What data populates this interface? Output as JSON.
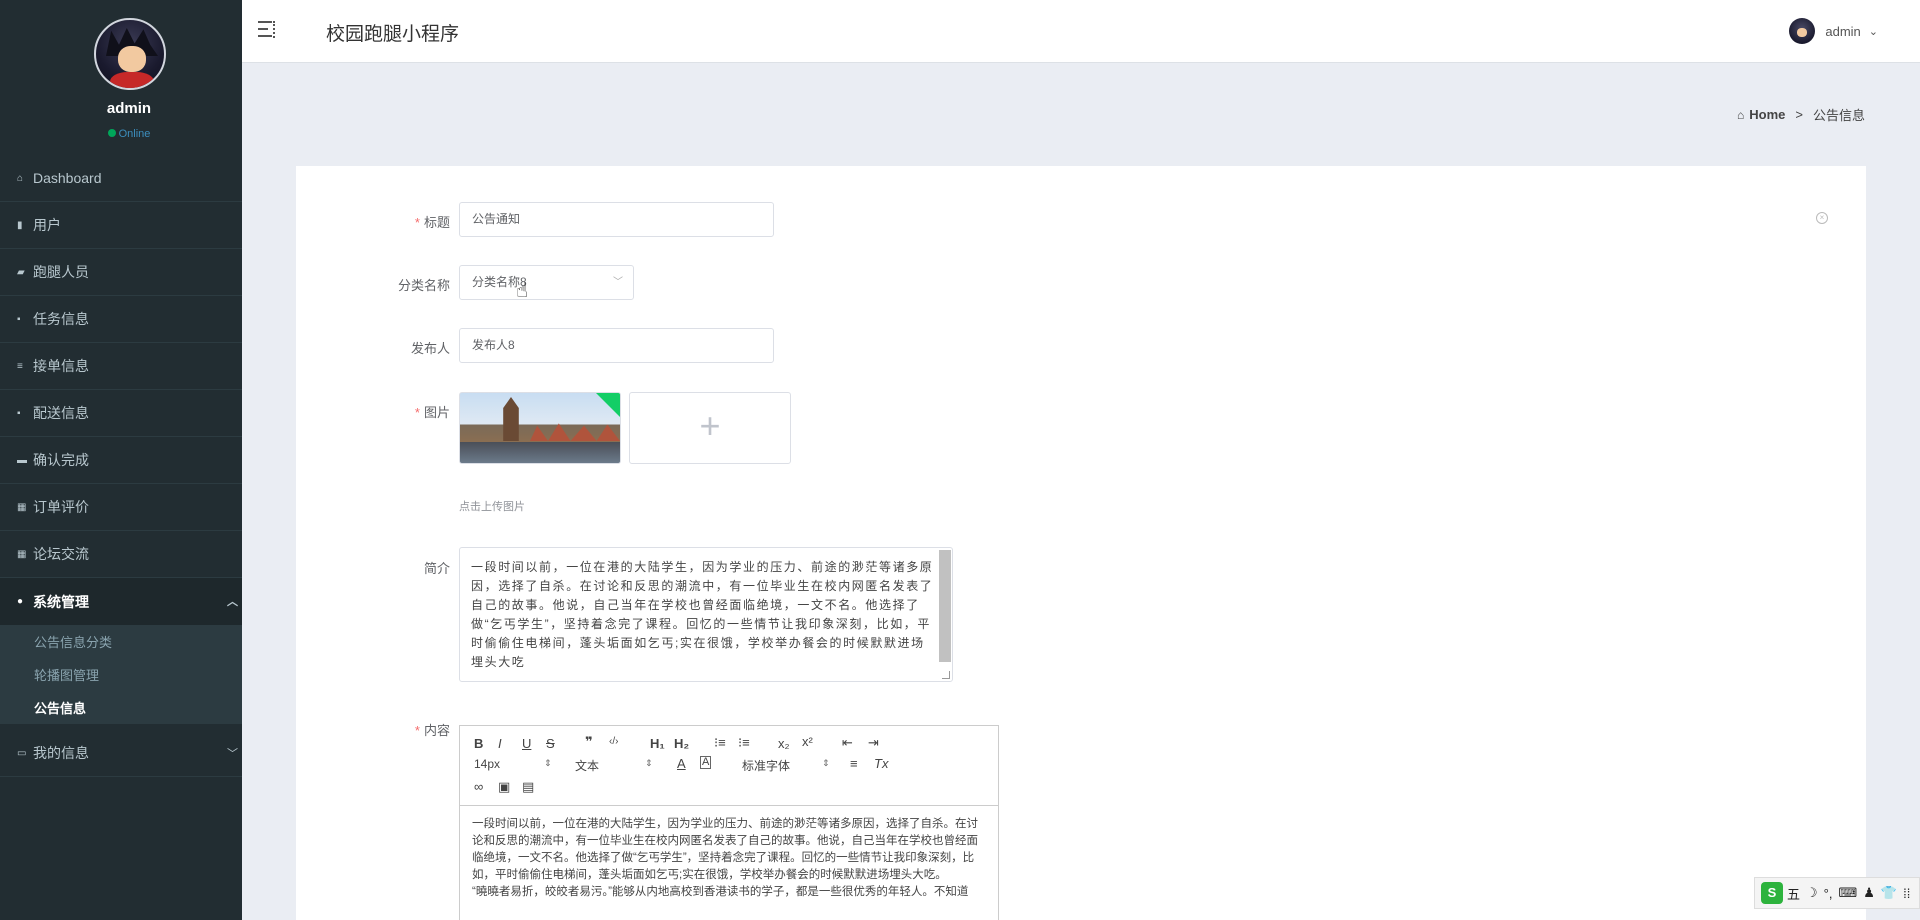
{
  "sidebar": {
    "user_name": "admin",
    "user_status": "Online",
    "items": [
      {
        "label": "Dashboard",
        "icon": "home-icon"
      },
      {
        "label": "用户",
        "icon": "bar-chart-icon"
      },
      {
        "label": "跑腿人员",
        "icon": "truck-icon"
      },
      {
        "label": "任务信息",
        "icon": "file-icon"
      },
      {
        "label": "接单信息",
        "icon": "list-icon"
      },
      {
        "label": "配送信息",
        "icon": "delivery-icon"
      },
      {
        "label": "确认完成",
        "icon": "check-box-icon"
      },
      {
        "label": "订单评价",
        "icon": "grid-icon"
      },
      {
        "label": "论坛交流",
        "icon": "grid-icon"
      },
      {
        "label": "系统管理",
        "icon": "user-icon"
      },
      {
        "label": "我的信息",
        "icon": "card-icon"
      }
    ],
    "sub_items": [
      {
        "label": "公告信息分类"
      },
      {
        "label": "轮播图管理"
      },
      {
        "label": "公告信息"
      }
    ]
  },
  "header": {
    "title": "校园跑腿小程序",
    "user": "admin"
  },
  "breadcrumb": {
    "home": "Home",
    "separator": ">",
    "current": "公告信息"
  },
  "form": {
    "title_label": "标题",
    "title_value": "公告通知",
    "category_label": "分类名称",
    "category_value": "分类名称8",
    "publisher_label": "发布人",
    "publisher_value": "发布人8",
    "image_label": "图片",
    "upload_plus": "+",
    "upload_hint": "点击上传图片",
    "summary_label": "简介",
    "summary_value": "一段时间以前，一位在港的大陆学生，因为学业的压力、前途的渺茫等诸多原因，选择了自杀。在讨论和反思的潮流中，有一位毕业生在校内网匿名发表了自己的故事。他说，自己当年在学校也曾经面临绝境，一文不名。他选择了做“乞丐学生”，坚持着念完了课程。回忆的一些情节让我印象深刻，比如，平时偷偷住电梯间，蓬头垢面如乞丐;实在很饿，学校举办餐会的时候默默进场埋头大吃",
    "content_label": "内容"
  },
  "editor": {
    "font_size": "14px",
    "block_type": "文本",
    "font_family": "标准字体",
    "body_line1": "一段时间以前，一位在港的大陆学生，因为学业的压力、前途的渺茫等诸多原因，选择了自杀。在讨论和反思的潮流中，有一位毕业生在校内网匿名发表了自己的故事。他说，自己当年在学校也曾经面临绝境，一文不名。他选择了做“乞丐学生”，坚持着念完了课程。回忆的一些情节让我印象深刻，比如，平时偷偷住电梯间，蓬头垢面如乞丐;实在很饿，学校举办餐会的时候默默进场埋头大吃。",
    "body_line2": "“曉曉者易折，皎皎者易污。”能够从内地高校到香港读书的学子，都是一些很优秀的年轻人。不知道"
  },
  "ime": {
    "logo": "S",
    "mode": "五",
    "moon": "☽",
    "punct": "°,",
    "keyboard": "⌨",
    "person": "♟",
    "shirt": "👕",
    "grid": "⁞⁞"
  }
}
